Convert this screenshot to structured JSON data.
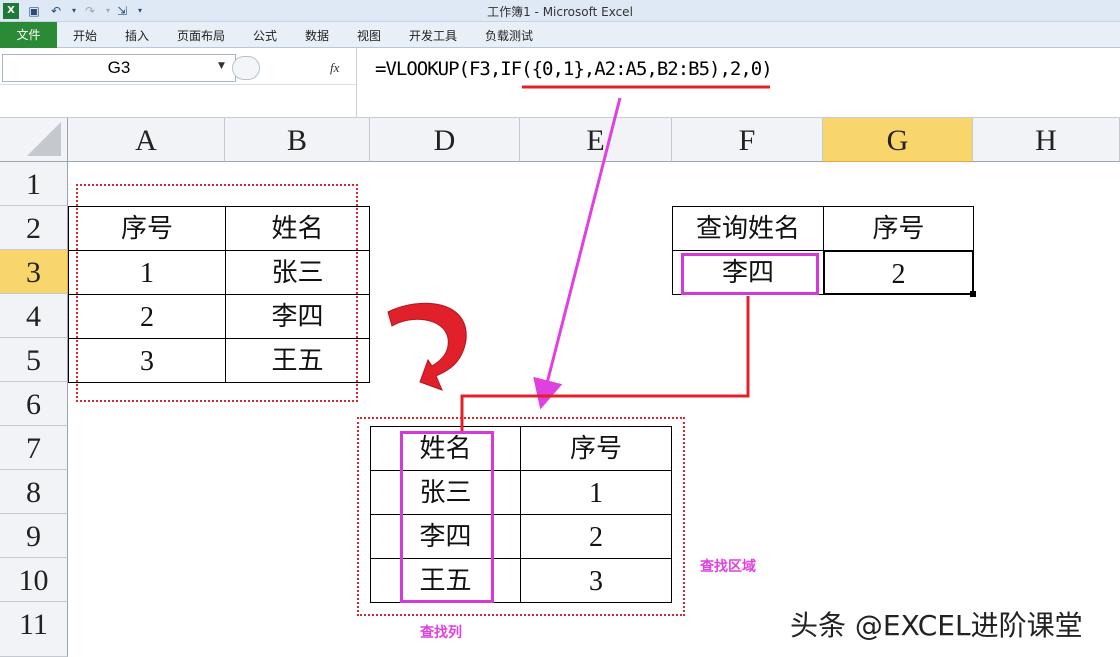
{
  "window": {
    "title": "工作簿1 - Microsoft Excel"
  },
  "ribbon": {
    "file_tab": "文件",
    "tabs": [
      "开始",
      "插入",
      "页面布局",
      "公式",
      "数据",
      "视图",
      "开发工具",
      "负载测试"
    ]
  },
  "formula_bar": {
    "name_box": "G3",
    "fx": "fx",
    "formula": "=VLOOKUP(F3,IF({0,1},A2:A5,B2:B5),2,0)"
  },
  "grid": {
    "columns": [
      "A",
      "B",
      "D",
      "E",
      "F",
      "G",
      "H"
    ],
    "rows": [
      "1",
      "2",
      "3",
      "4",
      "5",
      "6",
      "7",
      "8",
      "9",
      "10",
      "11"
    ],
    "selected_column": "G",
    "selected_row": "3"
  },
  "source_table": {
    "headers": [
      "序号",
      "姓名"
    ],
    "rows": [
      [
        "1",
        "张三"
      ],
      [
        "2",
        "李四"
      ],
      [
        "3",
        "王五"
      ]
    ]
  },
  "lookup_table": {
    "headers": [
      "查询姓名",
      "序号"
    ],
    "row": [
      "李四",
      "2"
    ]
  },
  "virtual_table": {
    "headers": [
      "姓名",
      "序号"
    ],
    "rows": [
      [
        "张三",
        "1"
      ],
      [
        "李四",
        "2"
      ],
      [
        "王五",
        "3"
      ]
    ]
  },
  "annotations": {
    "lookup_area": "查找区域",
    "lookup_column": "查找列"
  },
  "watermark": "头条 @EXCEL进阶课堂",
  "colors": {
    "accent_magenta": "#d43bd6",
    "arrow_red": "#e0202a",
    "selected_header": "#f9d66b",
    "file_tab_green": "#2a8a36"
  }
}
